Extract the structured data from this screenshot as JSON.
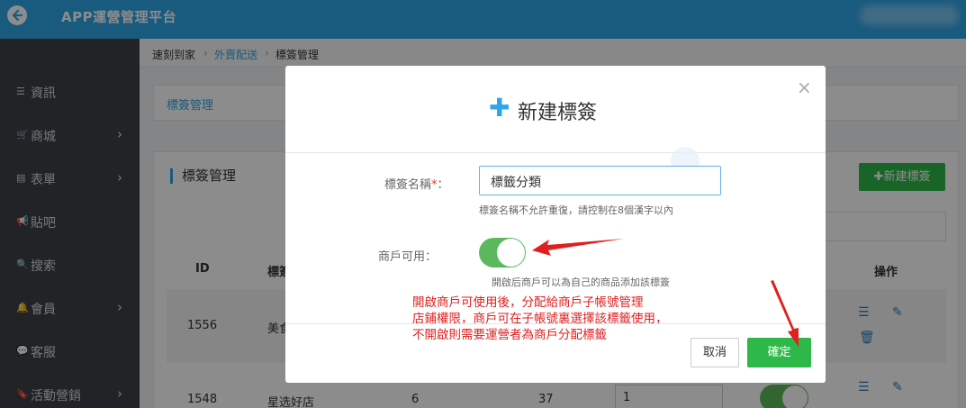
{
  "app": {
    "title": "APP運營管理平台"
  },
  "sidebar": {
    "items": [
      {
        "icon": "list-icon",
        "glyph": "☰",
        "label": "資訊",
        "arrow": false
      },
      {
        "icon": "cart-icon",
        "glyph": "🛒",
        "label": "商城",
        "arrow": true
      },
      {
        "icon": "form-icon",
        "glyph": "▤",
        "label": "表單",
        "arrow": true
      },
      {
        "icon": "megaphone-icon",
        "glyph": "📢",
        "label": "貼吧",
        "arrow": false
      },
      {
        "icon": "search-icon",
        "glyph": "🔍",
        "label": "搜索",
        "arrow": false
      },
      {
        "icon": "bell-icon",
        "glyph": "🔔",
        "label": "會員",
        "arrow": true
      },
      {
        "icon": "chat-icon",
        "glyph": "💬",
        "label": "客服",
        "arrow": false
      },
      {
        "icon": "bookmark-icon",
        "glyph": "🔖",
        "label": "活動營銷",
        "arrow": true
      }
    ]
  },
  "breadcrumb": {
    "home": "速刻到家",
    "section": "外賣配送",
    "current": "標簽管理"
  },
  "page_header": {
    "title": "標簽管理"
  },
  "panel": {
    "title": "標簽管理",
    "new_button": "新建標簽",
    "new_button_icon": "plus-icon"
  },
  "table": {
    "headers": {
      "id": "ID",
      "name": "標簽",
      "actions": "操作"
    },
    "rows": [
      {
        "id": "1556",
        "name": "美食"
      },
      {
        "id": "1548",
        "name": "星选好店",
        "count_a": "6",
        "count_b": "37",
        "sort": "1"
      }
    ]
  },
  "modal": {
    "title": "新建標簽",
    "title_icon": "plus-icon",
    "close_glyph": "×",
    "name_label": "標簽名稱",
    "required_mark": "*",
    "label_colon": "：",
    "name_value": "標籤分類",
    "name_hint": "標簽名稱不允許重復，請控制在8個漢字以內",
    "merchant_label": "商戶可用：",
    "merchant_enabled": true,
    "merchant_hint": "開啟后商戶可以為自己的商品添加該標簽",
    "note_lines": [
      "開啟商戶可使用後，分配給商戶子帳號管理",
      "店鋪權限，商戶可在子帳號裏選擇該標籤使用，",
      "不開啟則需要運營者為商戶分配標籤"
    ],
    "cancel_label": "取消",
    "confirm_label": "確定"
  },
  "colors": {
    "accent": "#2fa4e7",
    "success": "#2eb84a",
    "annotation": "#e02020",
    "sidebar_bg": "#3d4145"
  }
}
